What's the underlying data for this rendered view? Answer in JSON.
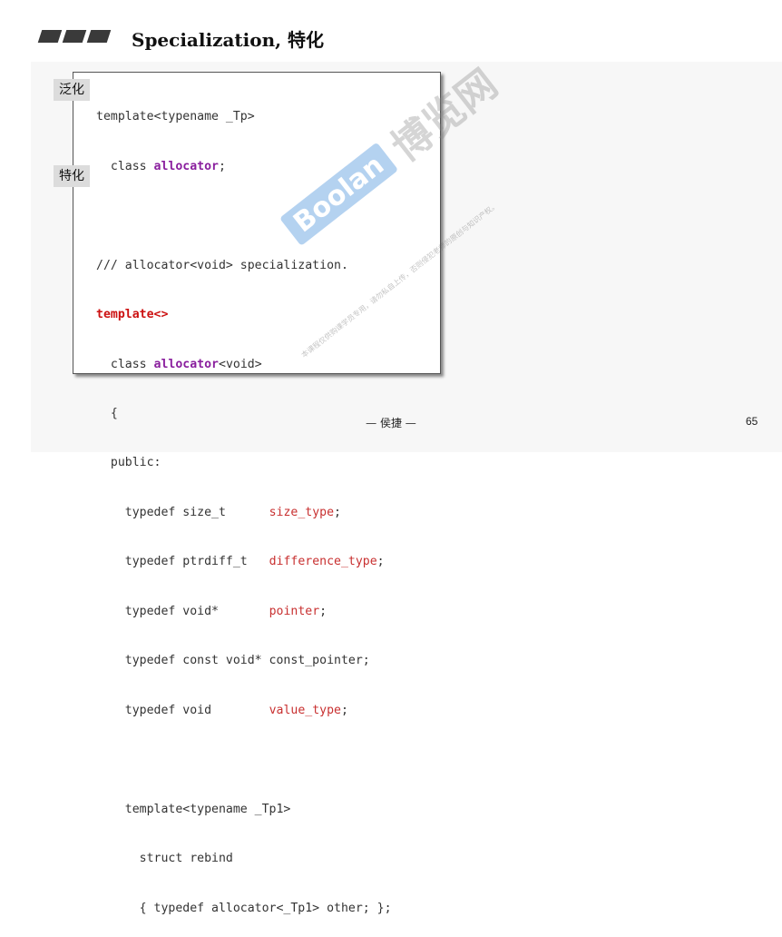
{
  "title": "Specialization, 特化",
  "labels": {
    "generalization": "泛化",
    "specialization": "特化"
  },
  "code": {
    "l1": "template<typename _Tp>",
    "l2_pre": "  class ",
    "l2_kw": "allocator",
    "l2_post": ";",
    "l3": "",
    "l4": "/// allocator<void> specialization.",
    "l5": "template<>",
    "l6_pre": "  class ",
    "l6_kw": "allocator",
    "l6_post": "<void>",
    "l7": "  {",
    "l8": "  public:",
    "l9_pre": "    typedef size_t      ",
    "l9_type": "size_type",
    "l9_post": ";",
    "l10_pre": "    typedef ptrdiff_t   ",
    "l10_type": "difference_type",
    "l10_post": ";",
    "l11_pre": "    typedef void*       ",
    "l11_type": "pointer",
    "l11_post": ";",
    "l12": "    typedef const void* const_pointer;",
    "l13_pre": "    typedef void        ",
    "l13_type": "value_type",
    "l13_post": ";",
    "l14": "",
    "l15": "    template<typename _Tp1>",
    "l16": "      struct rebind",
    "l17": "      { typedef allocator<_Tp1> other; };",
    "l18": "  };"
  },
  "watermark": {
    "logo": "Boolan",
    "cn": "博览网",
    "small": "本课程仅供购课学员专用，请勿私自上传，否则侵犯老师的原创与知识产权。"
  },
  "footer": {
    "author": "— 侯捷 —",
    "page": "65"
  },
  "colors": {
    "keyword_red": "#cc1111",
    "class_purple": "#8a1f9e",
    "type_red": "#c83030"
  }
}
